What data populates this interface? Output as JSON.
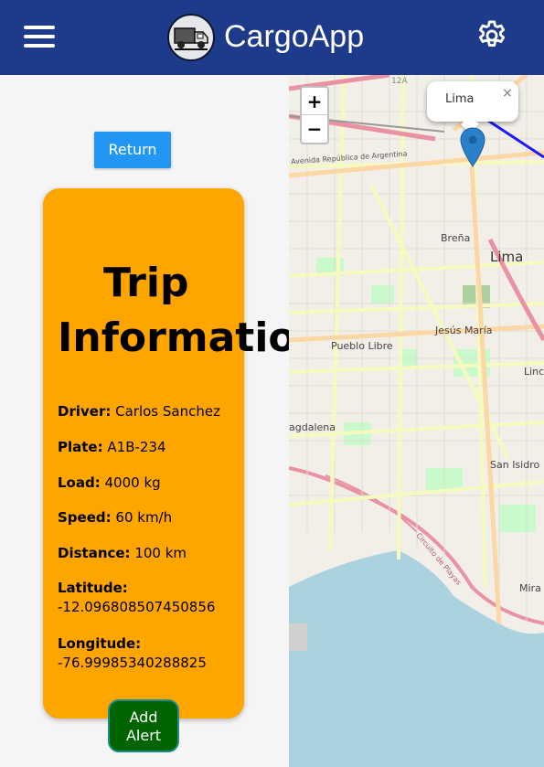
{
  "header": {
    "app_title": "CargoApp",
    "menu_icon": "hamburger-menu-icon",
    "logo_icon": "truck-logo-icon",
    "settings_icon": "gear-icon",
    "background_color": "#1e3a8a"
  },
  "actions": {
    "return_label": "Return",
    "add_alert_label_line1": "Add",
    "add_alert_label_line2": "Alert"
  },
  "trip": {
    "title_line1": "Trip",
    "title_line2": "Informatio",
    "card_color": "#ffa500",
    "driver_label": "Driver:",
    "driver_value": "Carlos Sanchez",
    "plate_label": "Plate:",
    "plate_value": "A1B-234",
    "load_label": "Load:",
    "load_value": "4000 kg",
    "speed_label": "Speed:",
    "speed_value": "60 km/h",
    "distance_label": "Distance:",
    "distance_value": "100 km",
    "latitude_label": "Latitude:",
    "latitude_value": "-12.096808507450856",
    "longitude_label": "Longitude:",
    "longitude_value": "-76.99985340288825"
  },
  "map": {
    "zoom_in_label": "+",
    "zoom_out_label": "−",
    "popup_text": "Lima",
    "popup_close": "×",
    "marker_icon": "map-pin-icon",
    "labels": {
      "lima": "Lima",
      "brena": "Breña",
      "jesus_maria": "Jesús María",
      "pueblo_libre": "Pueblo Libre",
      "lince": "Linc",
      "magdalena": "agdalena",
      "san_isidro": "San Isidro",
      "miraflores": "Mira",
      "avenida": "Avenida República de Argentina",
      "circuito": "Circuito de Playas",
      "road_12a": "12A"
    }
  }
}
